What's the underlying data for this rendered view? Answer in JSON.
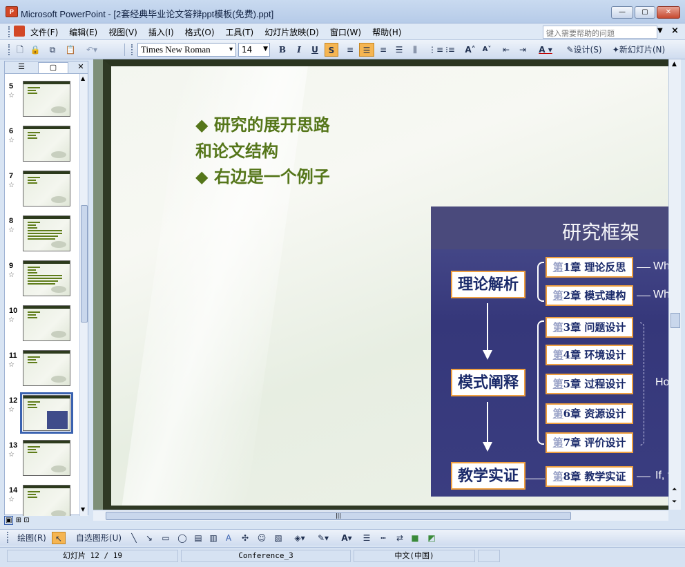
{
  "window": {
    "title": "Microsoft PowerPoint - [2套经典毕业论文答辩ppt模板(免费).ppt]",
    "minimize": "—",
    "maximize": "▢",
    "close": "✕"
  },
  "menu": {
    "items": [
      "文件(F)",
      "编辑(E)",
      "视图(V)",
      "插入(I)",
      "格式(O)",
      "工具(T)",
      "幻灯片放映(D)",
      "窗口(W)",
      "帮助(H)"
    ],
    "help_placeholder": "键入需要帮助的问题",
    "close": "×"
  },
  "toolbar": {
    "font": "Times New Roman",
    "size": "14",
    "bold": "B",
    "italic": "I",
    "underline": "U",
    "shadow": "S",
    "design": "设计(S)",
    "new_slide": "新幻灯片(N)"
  },
  "left_panel": {
    "tab_outline": "☰",
    "tab_slides": "▢",
    "close": "✕",
    "selected": "12",
    "thumbnails": [
      {
        "num": "5"
      },
      {
        "num": "6"
      },
      {
        "num": "7"
      },
      {
        "num": "8"
      },
      {
        "num": "9"
      },
      {
        "num": "10"
      },
      {
        "num": "11"
      },
      {
        "num": "12"
      },
      {
        "num": "13"
      },
      {
        "num": "14"
      }
    ]
  },
  "slide": {
    "bullet1": "◆ 研究的展开思路",
    "bullet1_cont": "和论文结构",
    "bullet2": "◆ 右边是一个例子",
    "framework": {
      "title": "研究框架",
      "mains": [
        "理论解析",
        "模式阐释",
        "教学实证"
      ],
      "chapters": [
        {
          "first": "第",
          "rest": "1章 理论反思"
        },
        {
          "first": "第",
          "rest": "2章 模式建构"
        },
        {
          "first": "第",
          "rest": "3章 问题设计"
        },
        {
          "first": "第",
          "rest": "4章 环境设计"
        },
        {
          "first": "第",
          "rest": "5章 过程设计"
        },
        {
          "first": "第",
          "rest": "6章 资源设计"
        },
        {
          "first": "第",
          "rest": "7章 评价设计"
        },
        {
          "first": "第",
          "rest": "8章 教学实证"
        }
      ],
      "questions": [
        "Why",
        "Wha",
        "How",
        "If, t"
      ]
    }
  },
  "drawbar": {
    "draw": "绘图(R)",
    "autoshapes": "自选图形(U)"
  },
  "status": {
    "slide": "幻灯片 12 / 19",
    "template": "Conference_3",
    "language": "中文(中国)"
  }
}
